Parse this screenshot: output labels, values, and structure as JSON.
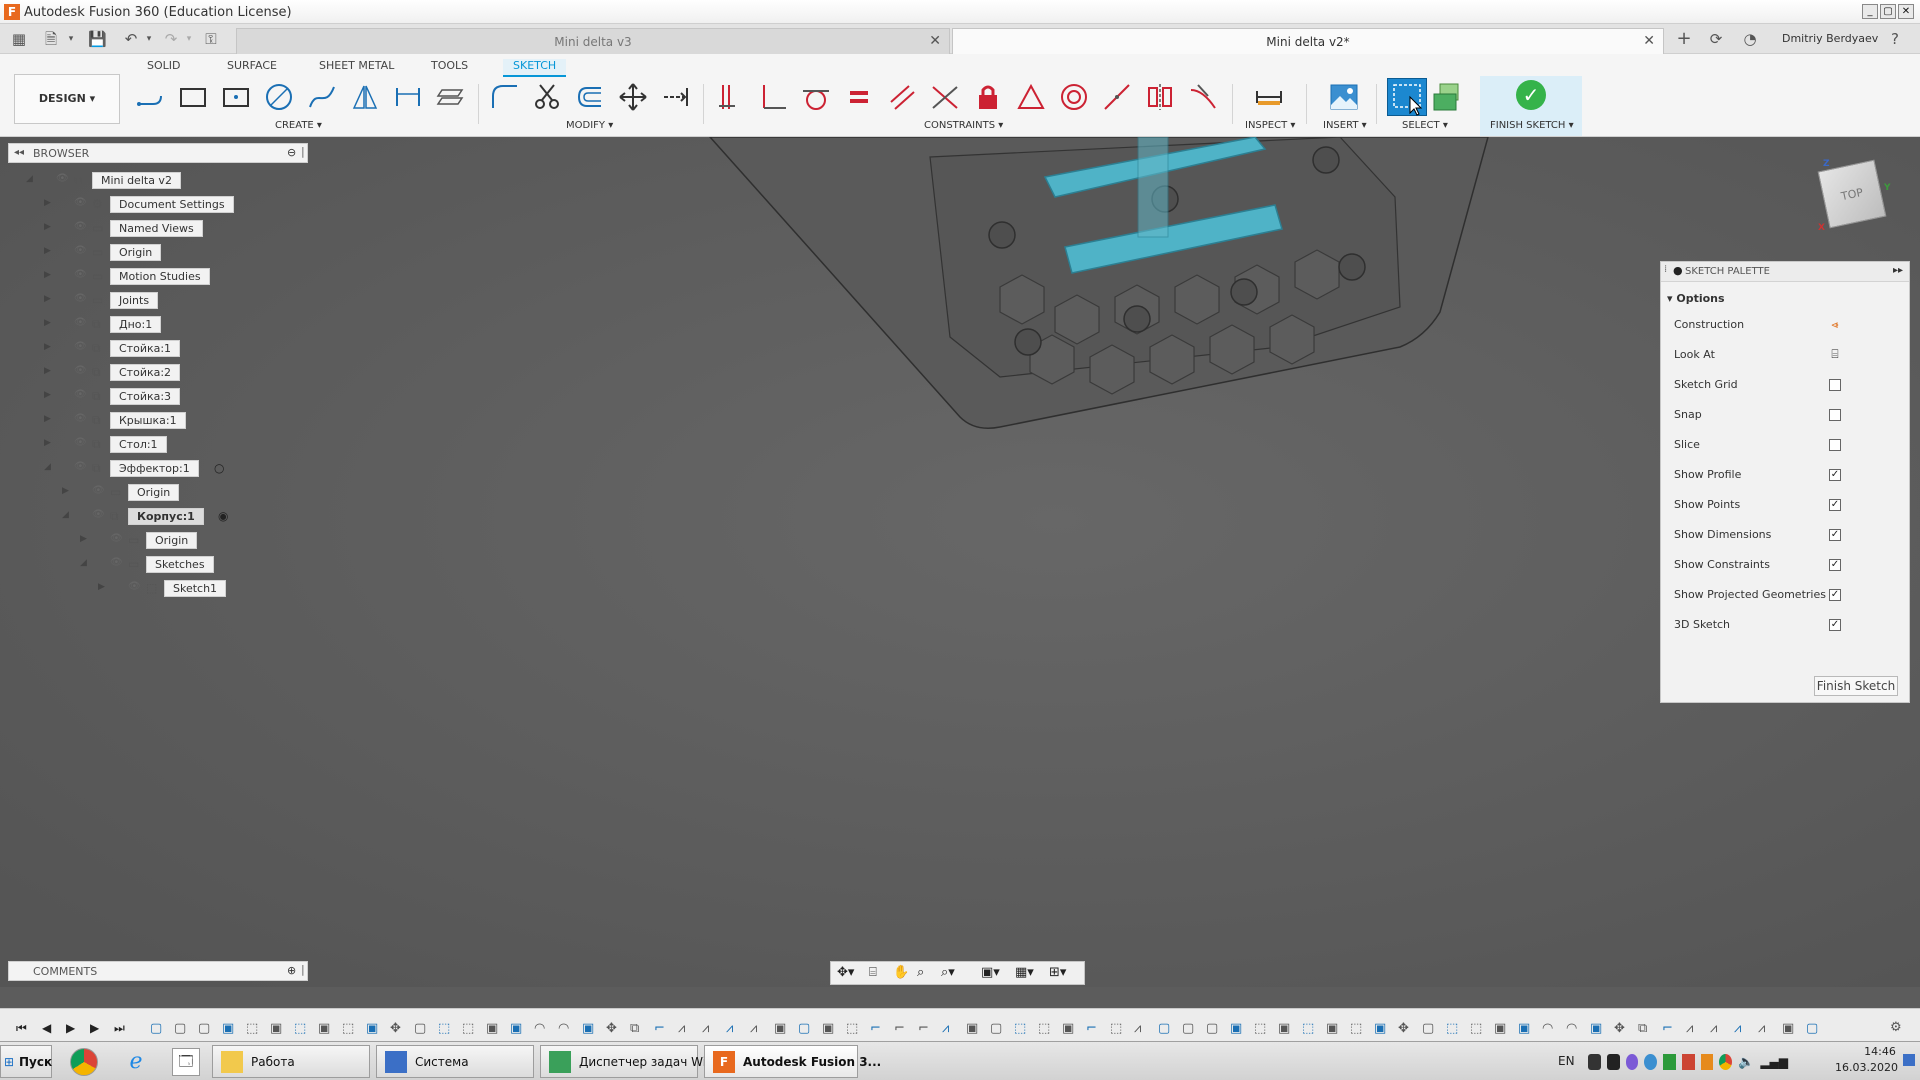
{
  "window": {
    "title": "Autodesk Fusion 360 (Education License)"
  },
  "tabs": [
    {
      "label": "Mini delta v3",
      "active": false
    },
    {
      "label": "Mini delta v2*",
      "active": true
    }
  ],
  "user": {
    "name": "Dmitriy Berdyaev"
  },
  "toolbar": {
    "tabs": [
      "SOLID",
      "SURFACE",
      "SHEET METAL",
      "TOOLS",
      "SKETCH"
    ],
    "active_tab": "SKETCH",
    "workspace": "DESIGN ▾",
    "groups": {
      "create": "CREATE ▾",
      "modify": "MODIFY ▾",
      "constraints": "CONSTRAINTS ▾",
      "inspect": "INSPECT ▾",
      "insert": "INSERT ▾",
      "select": "SELECT ▾",
      "finish": "FINISH SKETCH ▾"
    }
  },
  "browser": {
    "header": "BROWSER",
    "nodes": [
      {
        "label": "Mini delta v2",
        "depth": 0,
        "expanded": true
      },
      {
        "label": "Document Settings",
        "depth": 1
      },
      {
        "label": "Named Views",
        "depth": 1
      },
      {
        "label": "Origin",
        "depth": 1
      },
      {
        "label": "Motion Studies",
        "depth": 1
      },
      {
        "label": "Joints",
        "depth": 1
      },
      {
        "label": "Дно:1",
        "depth": 1
      },
      {
        "label": "Стойка:1",
        "depth": 1
      },
      {
        "label": "Стойка:2",
        "depth": 1
      },
      {
        "label": "Стойка:3",
        "depth": 1
      },
      {
        "label": "Крышка:1",
        "depth": 1
      },
      {
        "label": "Стол:1",
        "depth": 1
      },
      {
        "label": "Эффектор:1",
        "depth": 1,
        "expanded": true
      },
      {
        "label": "Origin",
        "depth": 2
      },
      {
        "label": "Корпус:1",
        "depth": 2,
        "expanded": true,
        "selected": true
      },
      {
        "label": "Origin",
        "depth": 3
      },
      {
        "label": "Sketches",
        "depth": 3,
        "expanded": true
      },
      {
        "label": "Sketch1",
        "depth": 4
      }
    ]
  },
  "viewcube": {
    "face": "TOP"
  },
  "palette": {
    "header": "SKETCH PALETTE",
    "section": "Options",
    "rows": [
      {
        "label": "Construction",
        "type": "icon"
      },
      {
        "label": "Look At",
        "type": "icon"
      },
      {
        "label": "Sketch Grid",
        "type": "check",
        "checked": false
      },
      {
        "label": "Snap",
        "type": "check",
        "checked": false
      },
      {
        "label": "Slice",
        "type": "check",
        "checked": false
      },
      {
        "label": "Show Profile",
        "type": "check",
        "checked": true
      },
      {
        "label": "Show Points",
        "type": "check",
        "checked": true
      },
      {
        "label": "Show Dimensions",
        "type": "check",
        "checked": true
      },
      {
        "label": "Show Constraints",
        "type": "check",
        "checked": true
      },
      {
        "label": "Show Projected Geometries",
        "type": "check",
        "checked": true
      },
      {
        "label": "3D Sketch",
        "type": "check",
        "checked": true
      }
    ],
    "finish_label": "Finish Sketch"
  },
  "comments": {
    "header": "COMMENTS"
  },
  "taskbar": {
    "start": "Пуск",
    "items": [
      {
        "label": "Работа"
      },
      {
        "label": "Система"
      },
      {
        "label": "Диспетчер задач Wi..."
      },
      {
        "label": "Autodesk Fusion 3..."
      }
    ],
    "lang": "EN",
    "time": "14:46",
    "date": "16.03.2020"
  },
  "colors": {
    "accent": "#0696d7",
    "sketch_fill": "#4fb3c7",
    "viewport": "#5e5e5e"
  }
}
